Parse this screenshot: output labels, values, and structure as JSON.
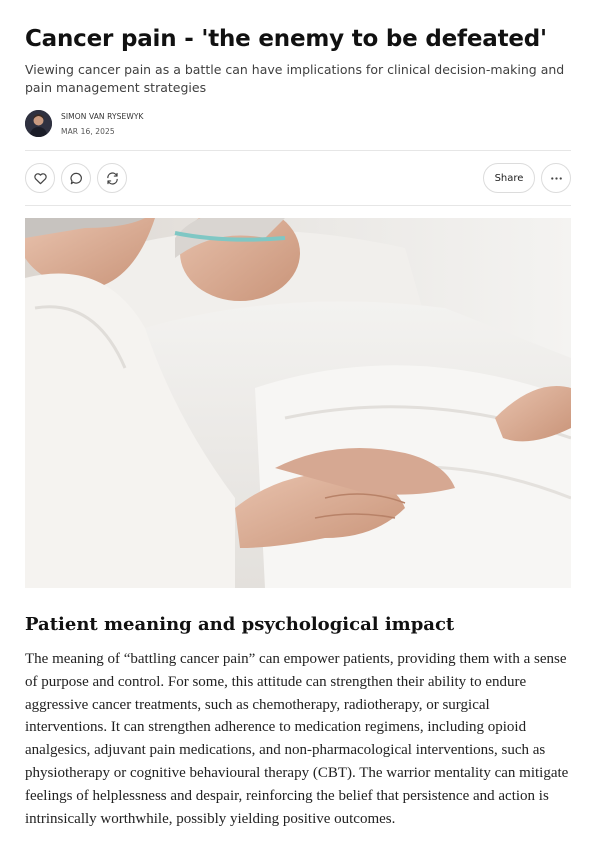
{
  "post": {
    "title": "Cancer pain - 'the enemy to be defeated'",
    "subtitle": "Viewing cancer pain as a battle can have implications for clinical decision-making and pain management strategies",
    "author": "SIMON VAN RYSEWYK",
    "date": "MAR 16, 2025"
  },
  "actions": {
    "like_icon": "heart-icon",
    "comment_icon": "comment-icon",
    "restack_icon": "restack-icon",
    "share_label": "Share",
    "more_icon": "more-icon"
  },
  "hero_image": {
    "subject": "photo"
  },
  "section": {
    "heading": "Patient meaning and psychological impact",
    "paragraph": "The meaning of “battling cancer pain” can empower patients, providing them with a sense of purpose and control. For some, this attitude can strengthen their ability to endure aggressive cancer treatments, such as chemotherapy, radiotherapy, or surgical interventions. It can strengthen adherence to medication regimens, including opioid analgesics, adjuvant pain medications, and non-pharmacological interventions, such as physiotherapy or cognitive behavioural therapy (CBT). The warrior mentality can mitigate feelings of helplessness and despair, reinforcing the belief that persistence and action is intrinsically worthwhile, possibly yielding positive outcomes."
  },
  "colors": {
    "text": "#111111",
    "muted": "#404040",
    "border": "#dcdcdc",
    "rule": "#e6e6e6"
  }
}
